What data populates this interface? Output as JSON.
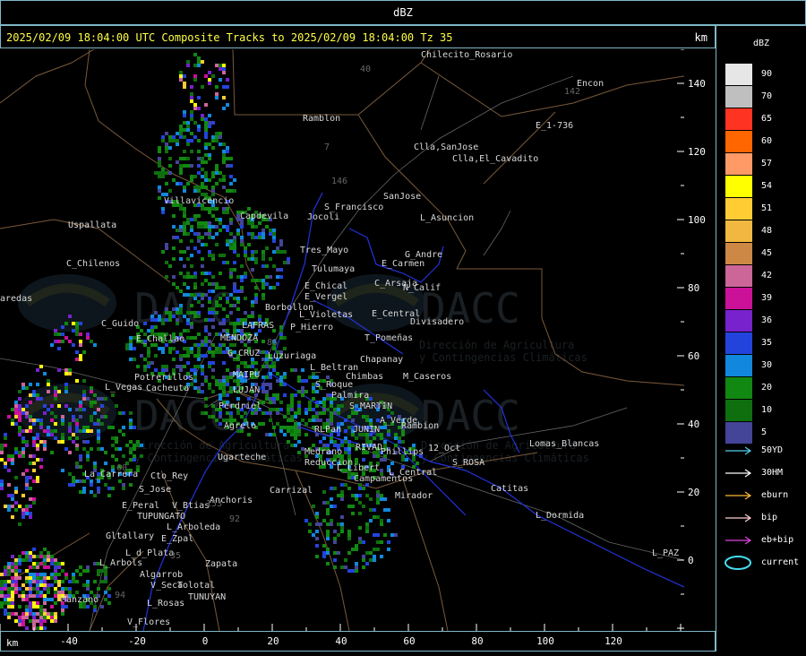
{
  "header": {
    "product": "dBZ"
  },
  "map": {
    "title": "2025/02/09 18:04:00 UTC Composite Tracks to 2025/02/09 18:04:00 Tz 35",
    "units": "km",
    "watermark": {
      "brand": "DACC",
      "line1": "Dirección de Agricultura",
      "line2": "y Contingencias Climáticas"
    },
    "places": [
      {
        "name": "Chilecito_Rosario"
      },
      {
        "name": "Encon"
      },
      {
        "name": "Ramblon"
      },
      {
        "name": "E_1-736"
      },
      {
        "name": "Clla,SanJose"
      },
      {
        "name": "Clla,El_Cavadito"
      },
      {
        "name": "Villavicencio"
      },
      {
        "name": "S_Francisco"
      },
      {
        "name": "SanJose"
      },
      {
        "name": "Uspallata"
      },
      {
        "name": "Capdevila"
      },
      {
        "name": "Jocoli"
      },
      {
        "name": "L_Asuncion"
      },
      {
        "name": "Tres_Mayo"
      },
      {
        "name": "G_Andre"
      },
      {
        "name": "Tulumaya"
      },
      {
        "name": "E_Carmen"
      },
      {
        "name": "C_Chilenos"
      },
      {
        "name": "E_Chical"
      },
      {
        "name": "C_Arsaja"
      },
      {
        "name": "N_Calif"
      },
      {
        "name": "E_Vergel"
      },
      {
        "name": "aredas"
      },
      {
        "name": "Borbollon"
      },
      {
        "name": "L_Violetas"
      },
      {
        "name": "E_Central"
      },
      {
        "name": "LAFRAS"
      },
      {
        "name": "P_Hierro"
      },
      {
        "name": "Divisadero"
      },
      {
        "name": "C_Guido"
      },
      {
        "name": "E_Challao"
      },
      {
        "name": "MENDOZA"
      },
      {
        "name": "T_Pomeñas"
      },
      {
        "name": "G_CRUZ"
      },
      {
        "name": "Luzuriaga"
      },
      {
        "name": "Chapanay"
      },
      {
        "name": "L_Beltran"
      },
      {
        "name": "MAIPU"
      },
      {
        "name": "Potrerillos"
      },
      {
        "name": "Chimbas"
      },
      {
        "name": "M_Caseros"
      },
      {
        "name": "L_Vegas"
      },
      {
        "name": "Cacheuta"
      },
      {
        "name": "S_Roque"
      },
      {
        "name": "LUJAN"
      },
      {
        "name": "Palmira"
      },
      {
        "name": "S_MARTIN"
      },
      {
        "name": "Perdriel"
      },
      {
        "name": "A_Verde"
      },
      {
        "name": "Agrelo"
      },
      {
        "name": "RLPan"
      },
      {
        "name": "JUNIN"
      },
      {
        "name": "Rambion"
      },
      {
        "name": "Lomas_Blancas"
      },
      {
        "name": "12_Oct"
      },
      {
        "name": "Medrano"
      },
      {
        "name": "RIVAD"
      },
      {
        "name": "Phillips"
      },
      {
        "name": "Ugarteche"
      },
      {
        "name": "Reduccion"
      },
      {
        "name": "L_Libert"
      },
      {
        "name": "S_ROSA"
      },
      {
        "name": "La_Carrera"
      },
      {
        "name": "L_Central"
      },
      {
        "name": "Cto_Rey"
      },
      {
        "name": "Campamentos"
      },
      {
        "name": "S_Jose"
      },
      {
        "name": "Carrizal"
      },
      {
        "name": "Mirador"
      },
      {
        "name": "Catitas"
      },
      {
        "name": "E_Peral"
      },
      {
        "name": "V_Btias"
      },
      {
        "name": "Anchoris"
      },
      {
        "name": "TUPUNGATO"
      },
      {
        "name": "L_Dormida"
      },
      {
        "name": "L_Arboleda"
      },
      {
        "name": "Gltallary"
      },
      {
        "name": "E_Zpal"
      },
      {
        "name": "L_d_Plata"
      },
      {
        "name": "L_PAZ"
      },
      {
        "name": "L_Arbols"
      },
      {
        "name": "Zapata"
      },
      {
        "name": "Algarrob"
      },
      {
        "name": "V_Seca"
      },
      {
        "name": "Tolotal"
      },
      {
        "name": "Manzano"
      },
      {
        "name": "TUNUYAN"
      },
      {
        "name": "L_Rosas"
      },
      {
        "name": "V_Flores"
      }
    ],
    "road_numbers": [
      "40",
      "142",
      "7",
      "146",
      "94",
      "92",
      "60",
      "40",
      "153",
      "86",
      "35"
    ]
  },
  "axes": {
    "x_label": "km",
    "x_ticks": [
      "-40",
      "-20",
      "0",
      "20",
      "40",
      "60",
      "80",
      "100",
      "120"
    ],
    "y_ticks": [
      "0",
      "20",
      "40",
      "60",
      "80",
      "100",
      "120",
      "140"
    ]
  },
  "legend": {
    "title": "dBZ",
    "levels": [
      {
        "label": "90",
        "color": "#e6e6e6"
      },
      {
        "label": "70",
        "color": "#bfbfbf"
      },
      {
        "label": "65",
        "color": "#ff3322"
      },
      {
        "label": "60",
        "color": "#ff6600"
      },
      {
        "label": "57",
        "color": "#ff9966"
      },
      {
        "label": "54",
        "color": "#ffff00"
      },
      {
        "label": "51",
        "color": "#ffcc33"
      },
      {
        "label": "48",
        "color": "#f0b840"
      },
      {
        "label": "45",
        "color": "#cc8844"
      },
      {
        "label": "42",
        "color": "#cc6699"
      },
      {
        "label": "39",
        "color": "#cc1199"
      },
      {
        "label": "36",
        "color": "#7722cc"
      },
      {
        "label": "35",
        "color": "#2244dd"
      },
      {
        "label": "30",
        "color": "#1188dd"
      },
      {
        "label": "20",
        "color": "#118811"
      },
      {
        "label": "10",
        "color": "#0f6f0f"
      },
      {
        "label": "5",
        "color": "#444499"
      }
    ],
    "tracks": [
      {
        "label": "50YD",
        "color": "#55ccee",
        "icon": "arrow-icon"
      },
      {
        "label": "30HM",
        "color": "#ffffff",
        "icon": "arrow-icon"
      },
      {
        "label": "eburn",
        "color": "#ffbb33",
        "icon": "arrow-icon"
      },
      {
        "label": "bip",
        "color": "#ffcccc",
        "icon": "arrow-icon"
      },
      {
        "label": "eb+bip",
        "color": "#dd44dd",
        "icon": "arrow-icon"
      },
      {
        "label": "current",
        "color": "#44ddee",
        "icon": "ellipse-icon"
      }
    ]
  }
}
